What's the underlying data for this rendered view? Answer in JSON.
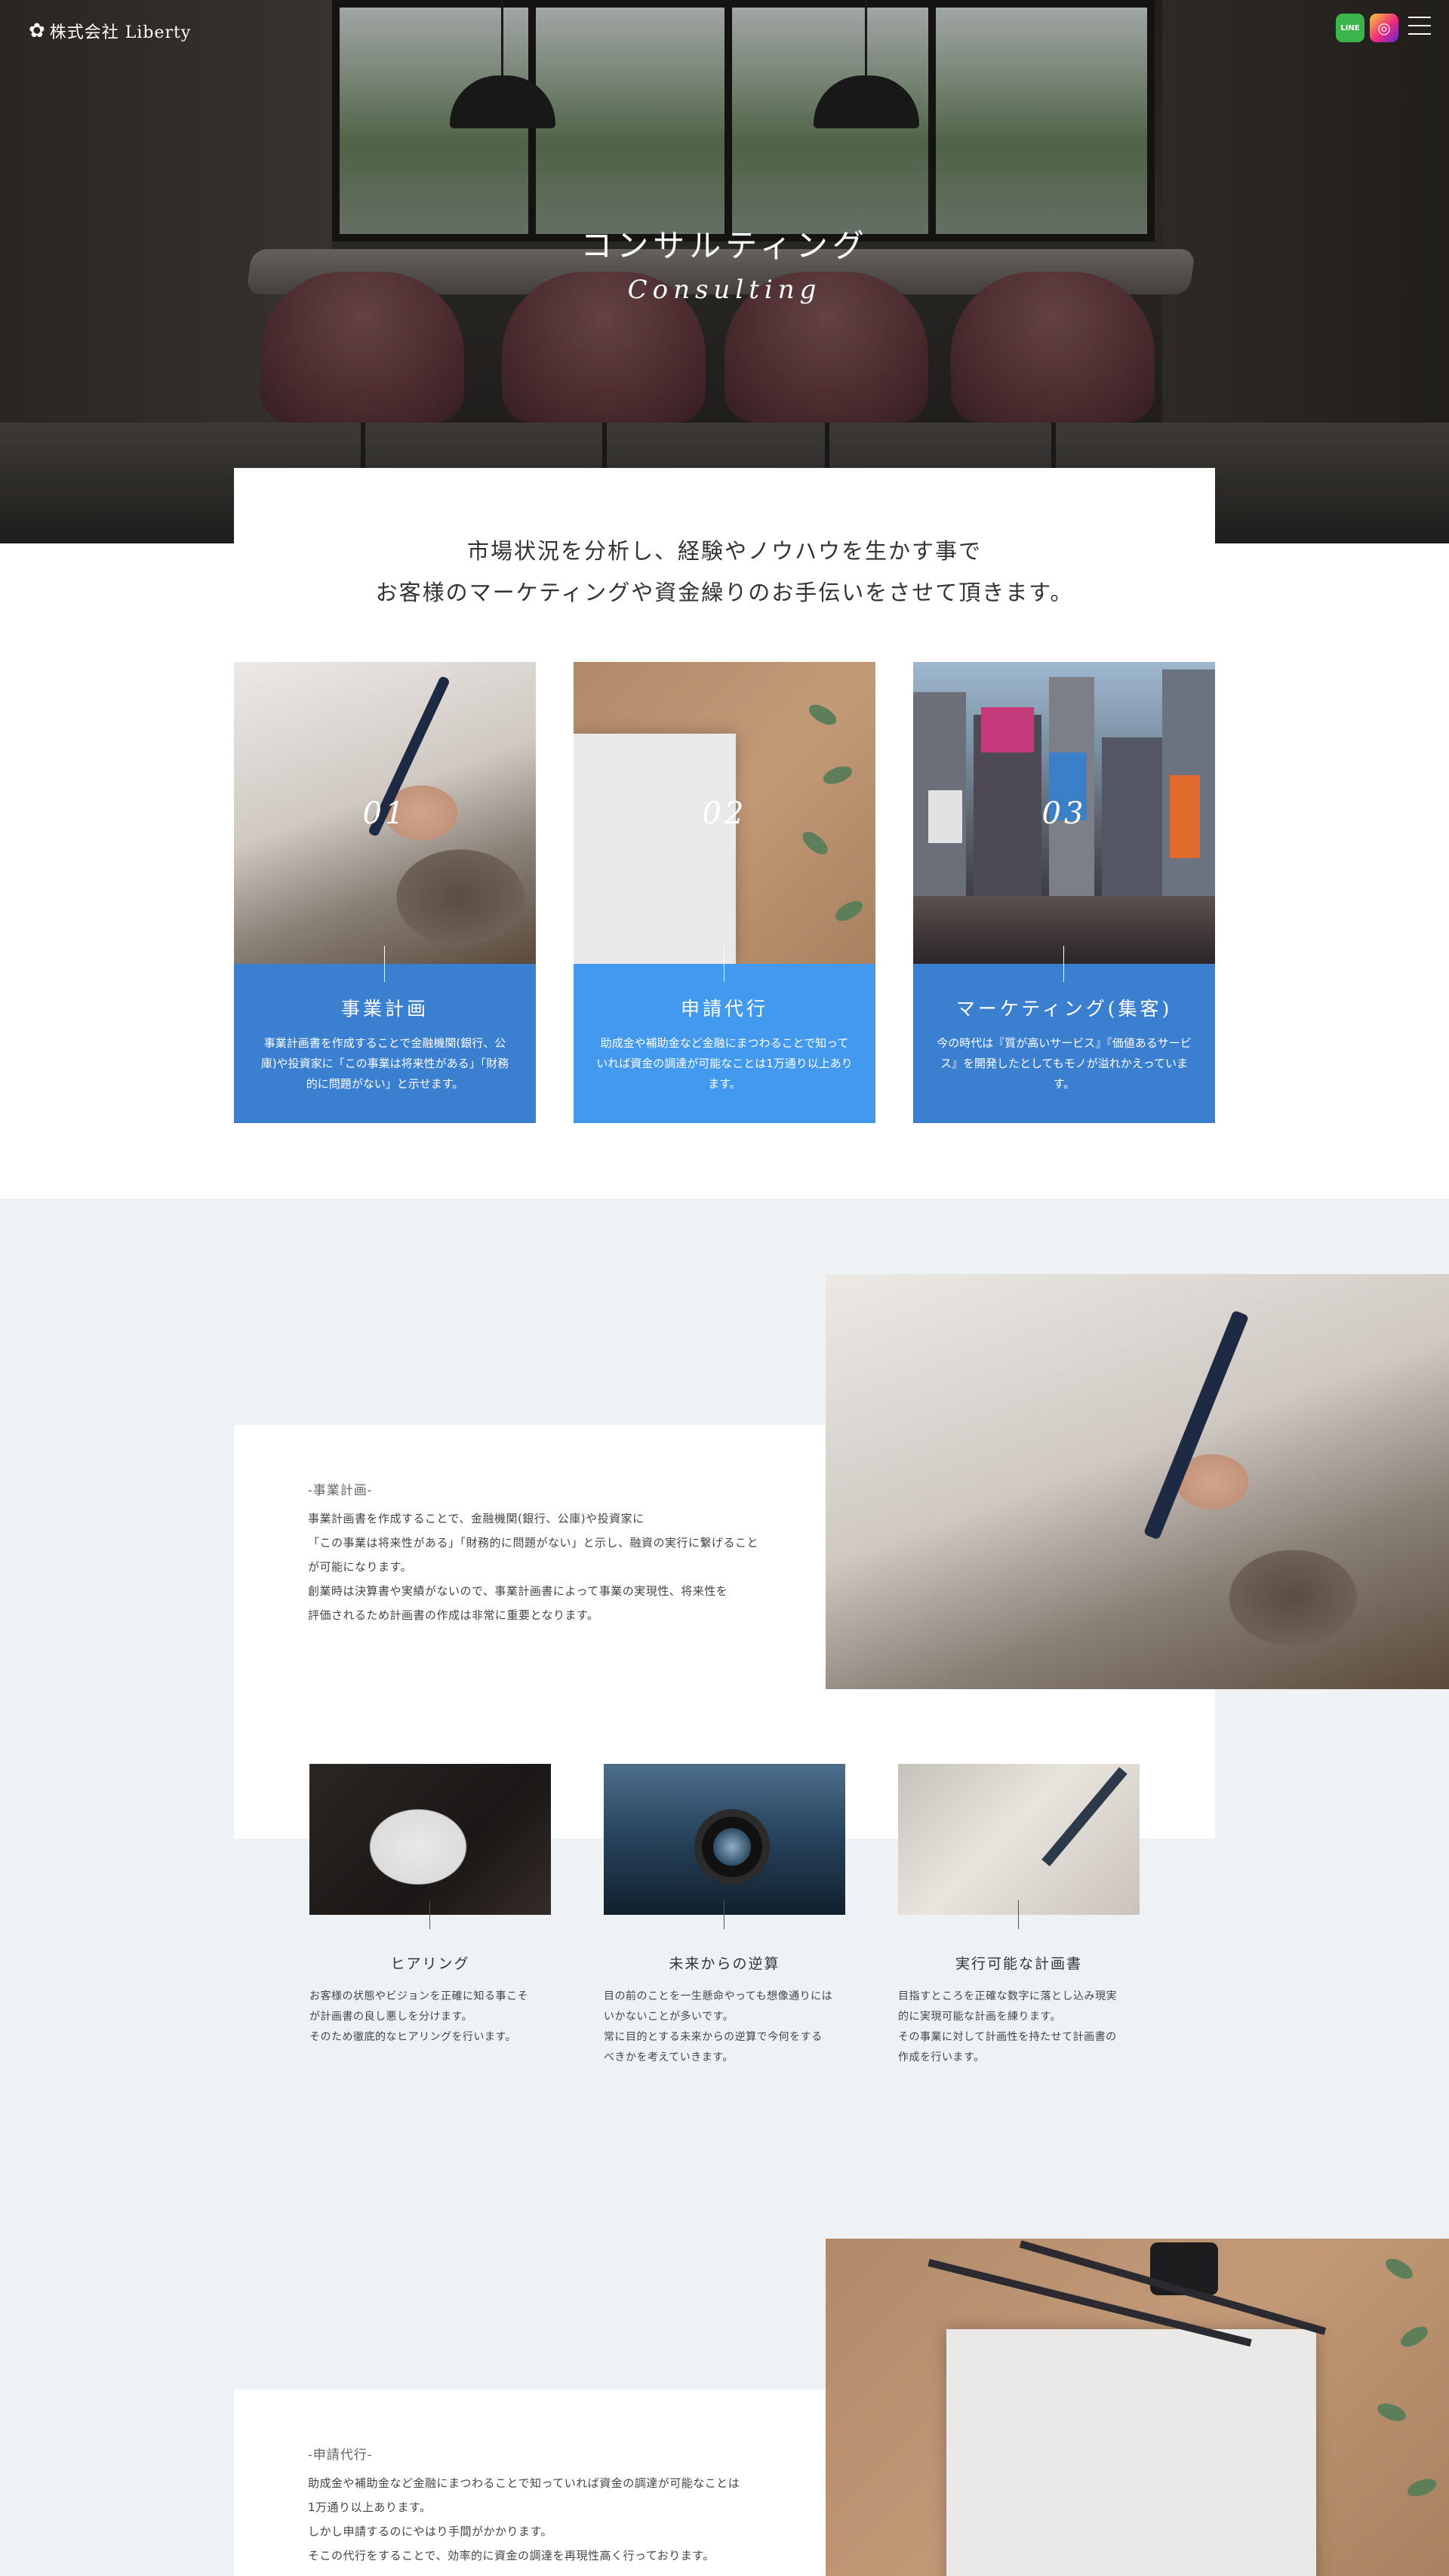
{
  "brand": {
    "logo_mark": "✿",
    "logo_text": "株式会社 Liberty"
  },
  "header": {
    "line_label": "LINE",
    "insta_label": "◎",
    "menu_icon": "hamburger-icon"
  },
  "hero": {
    "title_jp": "コンサルティング",
    "title_en": "Consulting"
  },
  "intro": {
    "line1": "市場状況を分析し、経験やノウハウを生かす事で",
    "line2": "お客様のマーケティングや資金繰りのお手伝いをさせて頂きます。"
  },
  "colors": {
    "card1": "#3a7fd0",
    "card2": "#4299ee",
    "card3": "#3a7fd0",
    "bg_grey": "#eef2f5"
  },
  "services": [
    {
      "num": "01",
      "title": "事業計画",
      "desc": "事業計画書を作成することで金融機関(銀行、公庫)や投資家に「この事業は将来性がある」「財務的に問題がない」と示せます。"
    },
    {
      "num": "02",
      "title": "申請代行",
      "desc": "助成金や補助金など金融にまつわることで知っていれば資金の調達が可能なことは1万通り以上あります。"
    },
    {
      "num": "03",
      "title": "マーケティング(集客)",
      "desc": "今の時代は『質が高いサービス』『価値あるサービス』を開発したとしてもモノが溢れかえっています。"
    }
  ],
  "detail1": {
    "label": "-事業計画-",
    "lines": [
      "事業計画書を作成することで、金融機関(銀行、公庫)や投資家に",
      "「この事業は将来性がある」「財務的に問題がない」と示し、融資の実行に繋げること",
      "が可能になります。",
      "創業時は決算書や実績がないので、事業計画書によって事業の実現性、将来性を",
      "評価されるため計画書の作成は非常に重要となります。"
    ]
  },
  "features": [
    {
      "title": "ヒアリング",
      "lines": [
        "お客様の状態やビジョンを正確に知る事こそ",
        "が計画書の良し悪しを分けます。",
        "そのため徹底的なヒアリングを行います。"
      ]
    },
    {
      "title": "未来からの逆算",
      "lines": [
        "目の前のことを一生懸命やっても想像通りには",
        "いかないことが多いです。",
        "常に目的とする未来からの逆算で今何をする",
        "べきかを考えていきます。"
      ]
    },
    {
      "title": "実行可能な計画書",
      "lines": [
        "目指すところを正確な数字に落とし込み現実",
        "的に実現可能な計画を練ります。",
        "その事業に対して計画性を持たせて計画書の",
        "作成を行います。"
      ]
    }
  ],
  "detail2": {
    "label": "-申請代行-",
    "lines": [
      "助成金や補助金など金融にまつわることで知っていれば資金の調達が可能なことは",
      "1万通り以上あります。",
      "しかし申請するのにやはり手間がかかります。",
      "そこの代行をすることで、効率的に資金の調達を再現性高く行っております。"
    ]
  }
}
